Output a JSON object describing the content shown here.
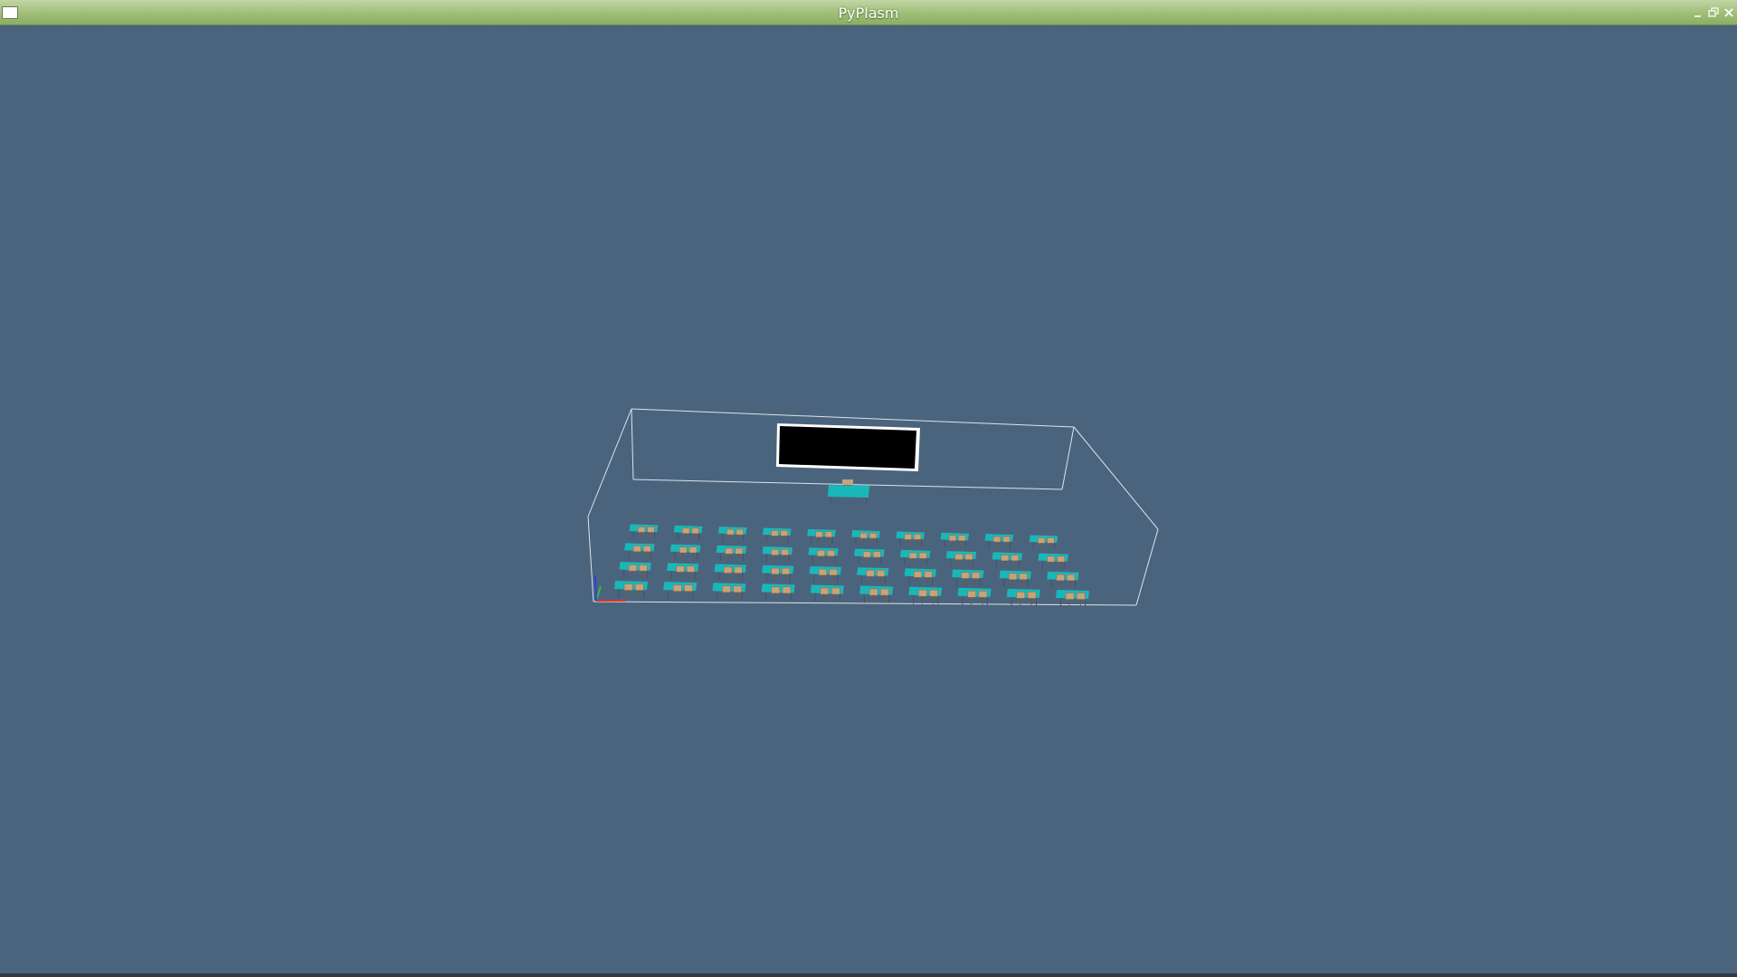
{
  "window": {
    "title": "PyPlasm",
    "controls": {
      "minimize": "minimize-icon",
      "restore": "restore-icon",
      "close": "close-icon"
    }
  },
  "viewport": {
    "background_color": "#4b647e",
    "scene": {
      "bounding_box_color": "#dde4ea",
      "blackboard_color": "#000000",
      "blackboard_frame_color": "#ffffff",
      "desk_color": "#19b8b8",
      "chair_color": "#c8a279",
      "desk_grid": {
        "rows": 4,
        "columns": 10
      },
      "axes_colors": {
        "x": "#e03030",
        "y": "#30c030",
        "z": "#3040e0"
      }
    }
  }
}
